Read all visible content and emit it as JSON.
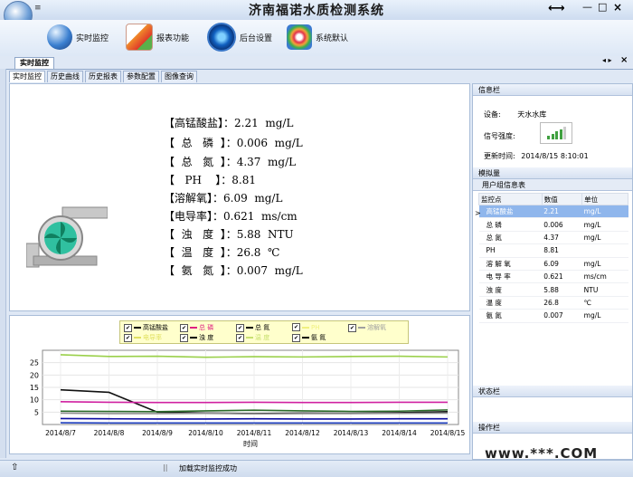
{
  "window": {
    "title": "济南福诺水质检测系统",
    "resize_glyph": "⟷",
    "qa_glyph": "≡",
    "minimize": "—",
    "maximize": "□",
    "close": "×"
  },
  "toolbar": [
    {
      "label": "实时监控",
      "icon": "monitor-globe-icon"
    },
    {
      "label": "报表功能",
      "icon": "report-icon"
    },
    {
      "label": "后台设置",
      "icon": "settings-icon"
    },
    {
      "label": "系统默认",
      "icon": "default-icon"
    }
  ],
  "doc_tab": {
    "label": "实时监控",
    "arrows": "◂ ▸",
    "close": "×"
  },
  "subtabs": [
    "实时监控",
    "历史曲线",
    "历史报表",
    "参数配置",
    "图像查询"
  ],
  "readings": [
    "【高锰酸盐】：2.21  mg/L",
    "【  总   磷  】：0.006  mg/L",
    "【  总   氮  】：4.37  mg/L",
    "【   PH    】：8.81",
    "【溶解氧】：6.09  mg/L",
    "【电导率】：0.621  ms/cm",
    "【  浊   度  】：5.88  NTU",
    "【  温   度  】：26.8  ℃",
    "【  氨   氮  】：0.007  mg/L"
  ],
  "legend": [
    {
      "name": "高锰酸盐",
      "color": "#000000"
    },
    {
      "name": "总  磷",
      "color": "#e02080"
    },
    {
      "name": "总  氮",
      "color": "#000000"
    },
    {
      "name": "PH",
      "color": "#f0f080"
    },
    {
      "name": "溶解氧",
      "color": "#a0a0a0"
    },
    {
      "name": "电导率",
      "color": "#e0e060"
    },
    {
      "name": "浊  度",
      "color": "#000000"
    },
    {
      "name": "温  度",
      "color": "#c8e070"
    },
    {
      "name": "氨  氮",
      "color": "#000000"
    }
  ],
  "checkmark": "✔",
  "chart_data": {
    "type": "line",
    "x": [
      "2014/8/7",
      "2014/8/8",
      "2014/8/9",
      "2014/8/10",
      "2014/8/11",
      "2014/8/12",
      "2014/8/13",
      "2014/8/14",
      "2014/8/15"
    ],
    "xlabel": "时间",
    "ylabel": "",
    "yticks": [
      5,
      10,
      15,
      20,
      25
    ],
    "ylim": [
      0,
      30
    ],
    "grid": true,
    "legend_position": "top-center",
    "series": [
      {
        "name": "温  度",
        "color": "#9ad04a",
        "values": [
          28.2,
          27.5,
          27.6,
          27.2,
          27.4,
          27.3,
          27.5,
          27.6,
          27.3
        ]
      },
      {
        "name": "总  氮",
        "color": "#111111",
        "values": [
          14.0,
          13.0,
          5.0,
          4.6,
          4.4,
          4.6,
          4.5,
          4.8,
          5.2
        ]
      },
      {
        "name": "PH",
        "color": "#d020a0",
        "values": [
          9.2,
          9.0,
          8.9,
          8.9,
          9.0,
          8.9,
          8.9,
          9.0,
          9.0
        ]
      },
      {
        "name": "溶解氧",
        "color": "#909090",
        "values": [
          4.6,
          4.4,
          4.4,
          4.5,
          4.3,
          4.4,
          4.4,
          4.5,
          4.6
        ]
      },
      {
        "name": "浊  度",
        "color": "#2a6a2a",
        "values": [
          5.4,
          5.3,
          5.2,
          5.5,
          5.8,
          5.5,
          5.3,
          5.4,
          5.9
        ]
      },
      {
        "name": "高锰酸盐",
        "color": "#0a0aa0",
        "values": [
          2.4,
          2.3,
          2.2,
          2.2,
          2.3,
          2.2,
          2.2,
          2.3,
          2.3
        ]
      },
      {
        "name": "电导率",
        "color": "#2040c0",
        "values": [
          0.7,
          0.6,
          0.6,
          0.6,
          0.6,
          0.6,
          0.6,
          0.6,
          0.6
        ]
      }
    ]
  },
  "info": {
    "header": "信息栏",
    "device_label": "设备:",
    "device_value": "天水水库",
    "signal_label": "信号强度:",
    "signal_level": 4,
    "signal_max": 5,
    "update_label": "更新时间:",
    "update_value": "2014/8/15 8:10:01"
  },
  "sim": {
    "header": "模拟量",
    "table_title": "用户组信息表",
    "columns": [
      "监控点",
      "数值",
      "单位"
    ],
    "selected_marker": ">",
    "rows": [
      [
        "高锰酸盐",
        "2.21",
        "mg/L"
      ],
      [
        "总   磷",
        "0.006",
        "mg/L"
      ],
      [
        "总   氮",
        "4.37",
        "mg/L"
      ],
      [
        "PH",
        "8.81",
        ""
      ],
      [
        "溶 解 氧",
        "6.09",
        "mg/L"
      ],
      [
        "电 导 率",
        "0.621",
        "ms/cm"
      ],
      [
        "浊   度",
        "5.88",
        "NTU"
      ],
      [
        "温   度",
        "26.8",
        "℃"
      ],
      [
        "氨   氮",
        "0.007",
        "mg/L"
      ]
    ]
  },
  "status_header": "状态栏",
  "ops_header": "操作栏",
  "statusbar": {
    "up": "⇧",
    "sep": "||",
    "message": "加载实时监控成功"
  },
  "watermark": "www.***.COM"
}
